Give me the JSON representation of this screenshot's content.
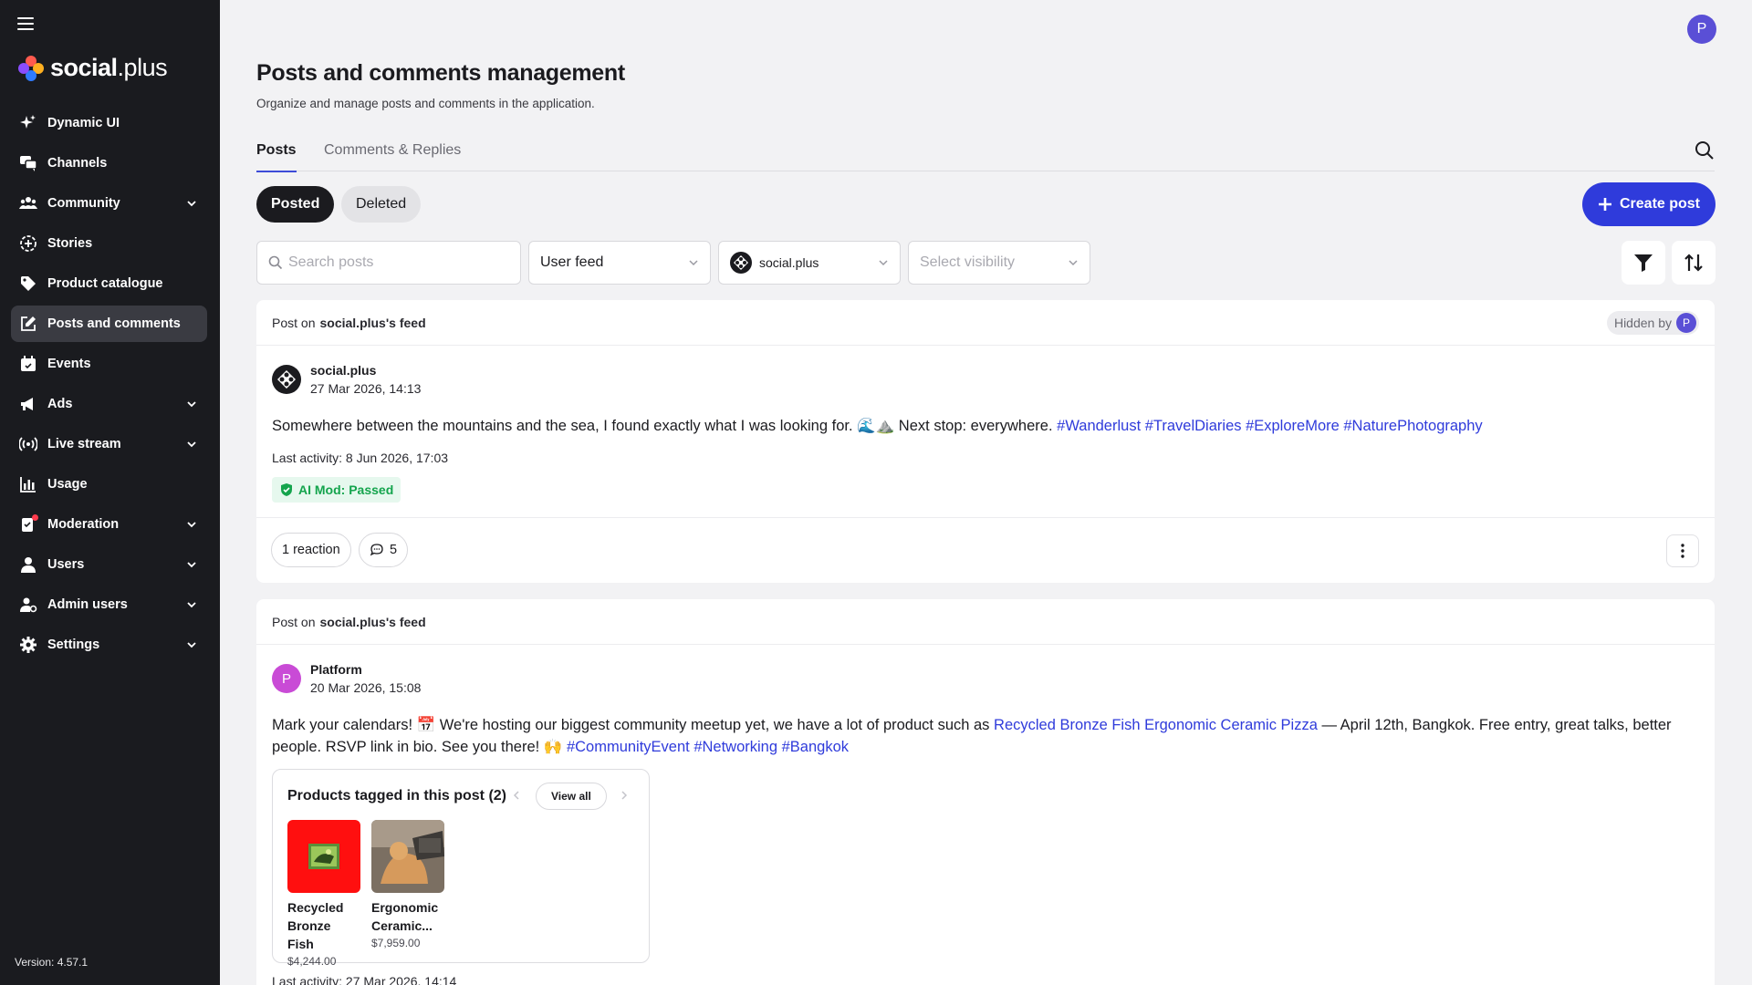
{
  "brand": {
    "name_bold": "social",
    "name_light": ".plus"
  },
  "sidebar": {
    "items": [
      {
        "label": "Dynamic UI",
        "icon": "sparkle-icon"
      },
      {
        "label": "Channels",
        "icon": "chat-icon"
      },
      {
        "label": "Community",
        "icon": "people-icon",
        "expandable": true
      },
      {
        "label": "Stories",
        "icon": "stories-icon"
      },
      {
        "label": "Product catalogue",
        "icon": "tag-icon"
      },
      {
        "label": "Posts and comments",
        "icon": "edit-icon",
        "active": true
      },
      {
        "label": "Events",
        "icon": "calendar-icon"
      },
      {
        "label": "Ads",
        "icon": "megaphone-icon",
        "expandable": true
      },
      {
        "label": "Live stream",
        "icon": "broadcast-icon",
        "expandable": true
      },
      {
        "label": "Usage",
        "icon": "bar-chart-icon"
      },
      {
        "label": "Moderation",
        "icon": "moderation-icon",
        "expandable": true,
        "notification": true
      },
      {
        "label": "Users",
        "icon": "user-icon",
        "expandable": true
      },
      {
        "label": "Admin users",
        "icon": "admin-user-icon",
        "expandable": true
      },
      {
        "label": "Settings",
        "icon": "gear-icon",
        "expandable": true
      }
    ],
    "version": "Version: 4.57.1"
  },
  "header": {
    "avatar_initial": "P",
    "title": "Posts and comments management",
    "subtitle": "Organize and manage posts and comments in the application."
  },
  "tabs": [
    {
      "label": "Posts",
      "active": true
    },
    {
      "label": "Comments & Replies",
      "active": false
    }
  ],
  "status_filter": {
    "posted": "Posted",
    "deleted": "Deleted"
  },
  "create_button": "Create post",
  "filters": {
    "search_placeholder": "Search posts",
    "feed_type": "User feed",
    "target": "social.plus",
    "visibility_placeholder": "Select visibility"
  },
  "posts": [
    {
      "feed_prefix": "Post on",
      "feed_name": "social.plus's feed",
      "hidden_by_label": "Hidden by",
      "hidden_by_initial": "P",
      "author": "social.plus",
      "date": "27 Mar 2026, 14:13",
      "text": "Somewhere between the mountains and the sea, I found exactly what I was looking for. 🌊⛰️ Next stop: everywhere.",
      "hashtags": "#Wanderlust #TravelDiaries #ExploreMore #NaturePhotography",
      "last_activity": "Last activity: 8 Jun 2026, 17:03",
      "ai_mod": "AI Mod: Passed",
      "reactions": "1 reaction",
      "comments": "5"
    },
    {
      "feed_prefix": "Post on",
      "feed_name": "social.plus's feed",
      "author_initial": "P",
      "author": "Platform",
      "date": "20 Mar 2026, 15:08",
      "text_before": "Mark your calendars! 📅 We're hosting our biggest community meetup yet, we have a lot of product such as",
      "product_link": "Recycled Bronze Fish Ergonomic Ceramic Pizza",
      "text_after": "— April 12th, Bangkok. Free entry, great talks, better",
      "text_line2": "people. RSVP link in bio. See you there! 🙌",
      "hashtags": "#CommunityEvent #Networking #Bangkok",
      "products_title": "Products tagged in this post (2)",
      "view_all": "View all",
      "products": [
        {
          "name": "Recycled Bronze Fish",
          "price": "$4,244.00"
        },
        {
          "name": "Ergonomic Ceramic...",
          "price": "$7,959.00"
        }
      ],
      "last_activity": "Last activity: 27 Mar 2026, 14:14"
    }
  ]
}
